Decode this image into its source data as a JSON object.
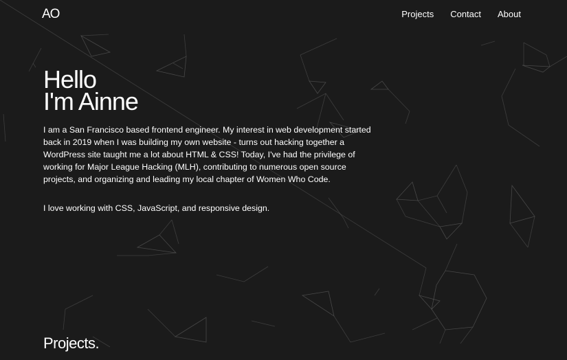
{
  "nav": {
    "logo": "AO",
    "links": [
      {
        "label": "Projects"
      },
      {
        "label": "Contact"
      },
      {
        "label": "About"
      }
    ]
  },
  "hero": {
    "title_line1": "Hello",
    "title_line2": "I'm Ainne",
    "bio": "I am a San Francisco based frontend engineer. My interest in web development started back in 2019 when I was building my own website - turns out hacking together a WordPress site taught me a lot about HTML & CSS! Today, I've had the privilege of working for Major League Hacking (MLH), contributing to numerous open source projects, and organizing and leading my local chapter of Women Who Code.",
    "skills": "I love working with CSS, JavaScript, and responsive design."
  },
  "projects": {
    "heading": "Projects."
  },
  "colors": {
    "background": "#1b1b1b",
    "text": "#ffffff",
    "mesh": "#5a5a5a"
  }
}
